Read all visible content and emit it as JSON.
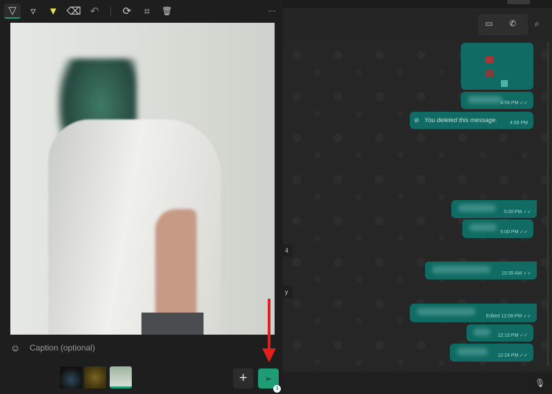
{
  "editor": {
    "toolbar": [
      {
        "name": "pen-thin-icon",
        "glyph": "▽"
      },
      {
        "name": "pen-icon",
        "glyph": "▿"
      },
      {
        "name": "highlighter-icon",
        "glyph": "▼"
      },
      {
        "name": "eraser-icon",
        "glyph": "⌫"
      },
      {
        "name": "undo-icon",
        "glyph": "↶"
      },
      {
        "name": "rotate-icon",
        "glyph": "⟳"
      },
      {
        "name": "crop-icon",
        "glyph": "⌗"
      },
      {
        "name": "delete-icon",
        "glyph": "🗑"
      },
      {
        "name": "more-icon",
        "glyph": "···"
      }
    ],
    "caption_placeholder": "Caption (optional)",
    "add_glyph": "+",
    "send_glyph": "➢",
    "send_count": "3"
  },
  "chat": {
    "date_chips": [
      "4",
      "y"
    ],
    "messages": [
      {
        "time": "4:59 PM",
        "ticks": "✓✓",
        "text": ""
      },
      {
        "time": "4:59 PM",
        "ticks": "",
        "text": "You deleted this message."
      },
      {
        "time": "5:00 PM",
        "ticks": "✓✓",
        "text": ""
      },
      {
        "time": "5:00 PM",
        "ticks": "✓✓",
        "text": ""
      },
      {
        "time": "10:35 AM",
        "ticks": "✓✓",
        "text": ""
      },
      {
        "time": "Edited 12:08 PM",
        "ticks": "✓✓",
        "text": ""
      },
      {
        "time": "12:13 PM",
        "ticks": "✓✓",
        "text": ""
      },
      {
        "time": "12:24 PM",
        "ticks": "✓✓",
        "text": ""
      }
    ]
  },
  "colors": {
    "bubble": "#0f6b63",
    "send": "#1d9c76",
    "arrow": "#e0201c"
  }
}
